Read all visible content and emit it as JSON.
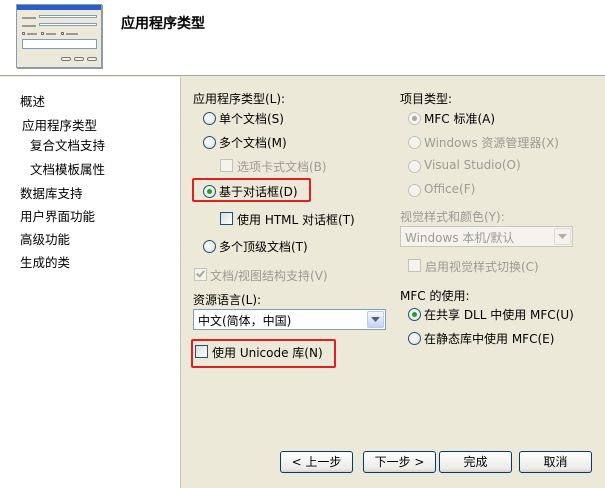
{
  "header": {
    "title": "应用程序类型"
  },
  "nav": {
    "items": [
      {
        "label": "概述"
      },
      {
        "label": "应用程序类型"
      },
      {
        "label": "复合文档支持"
      },
      {
        "label": "文档模板属性"
      },
      {
        "label": "数据库支持"
      },
      {
        "label": "用户界面功能"
      },
      {
        "label": "高级功能"
      },
      {
        "label": "生成的类"
      }
    ]
  },
  "app_type": {
    "label": "应用程序类型(L):",
    "single_doc": "单个文档(S)",
    "multi_doc": "多个文档(M)",
    "tabbed_doc": "选项卡式文档(B)",
    "dialog_based": "基于对话框(D)",
    "use_html_dialog": "使用 HTML 对话框(T)",
    "multi_toplevel": "多个顶级文档(T)",
    "doc_view_support": "文档/视图结构支持(V)"
  },
  "resource_lang": {
    "label": "资源语言(L):",
    "value": "中文(简体，中国)"
  },
  "unicode": {
    "label": "使用 Unicode 库(N)"
  },
  "project_type": {
    "label": "项目类型:",
    "mfc_standard": "MFC 标准(A)",
    "windows_explorer": "Windows 资源管理器(X)",
    "visual_studio": "Visual Studio(O)",
    "office": "Office(F)"
  },
  "visual_style": {
    "label": "视觉样式和颜色(Y):",
    "value": "Windows 本机/默认",
    "enable_switch": "启用视觉样式切换(C)"
  },
  "mfc_use": {
    "label": "MFC 的使用:",
    "shared_dll": "在共享 DLL 中使用 MFC(U)",
    "static_lib": "在静态库中使用 MFC(E)"
  },
  "buttons": {
    "prev": "< 上一步",
    "next": "下一步 >",
    "finish": "完成",
    "cancel": "取消"
  },
  "colors": {
    "highlight_border": "#e0201e",
    "radio_selected": "#21a121"
  }
}
